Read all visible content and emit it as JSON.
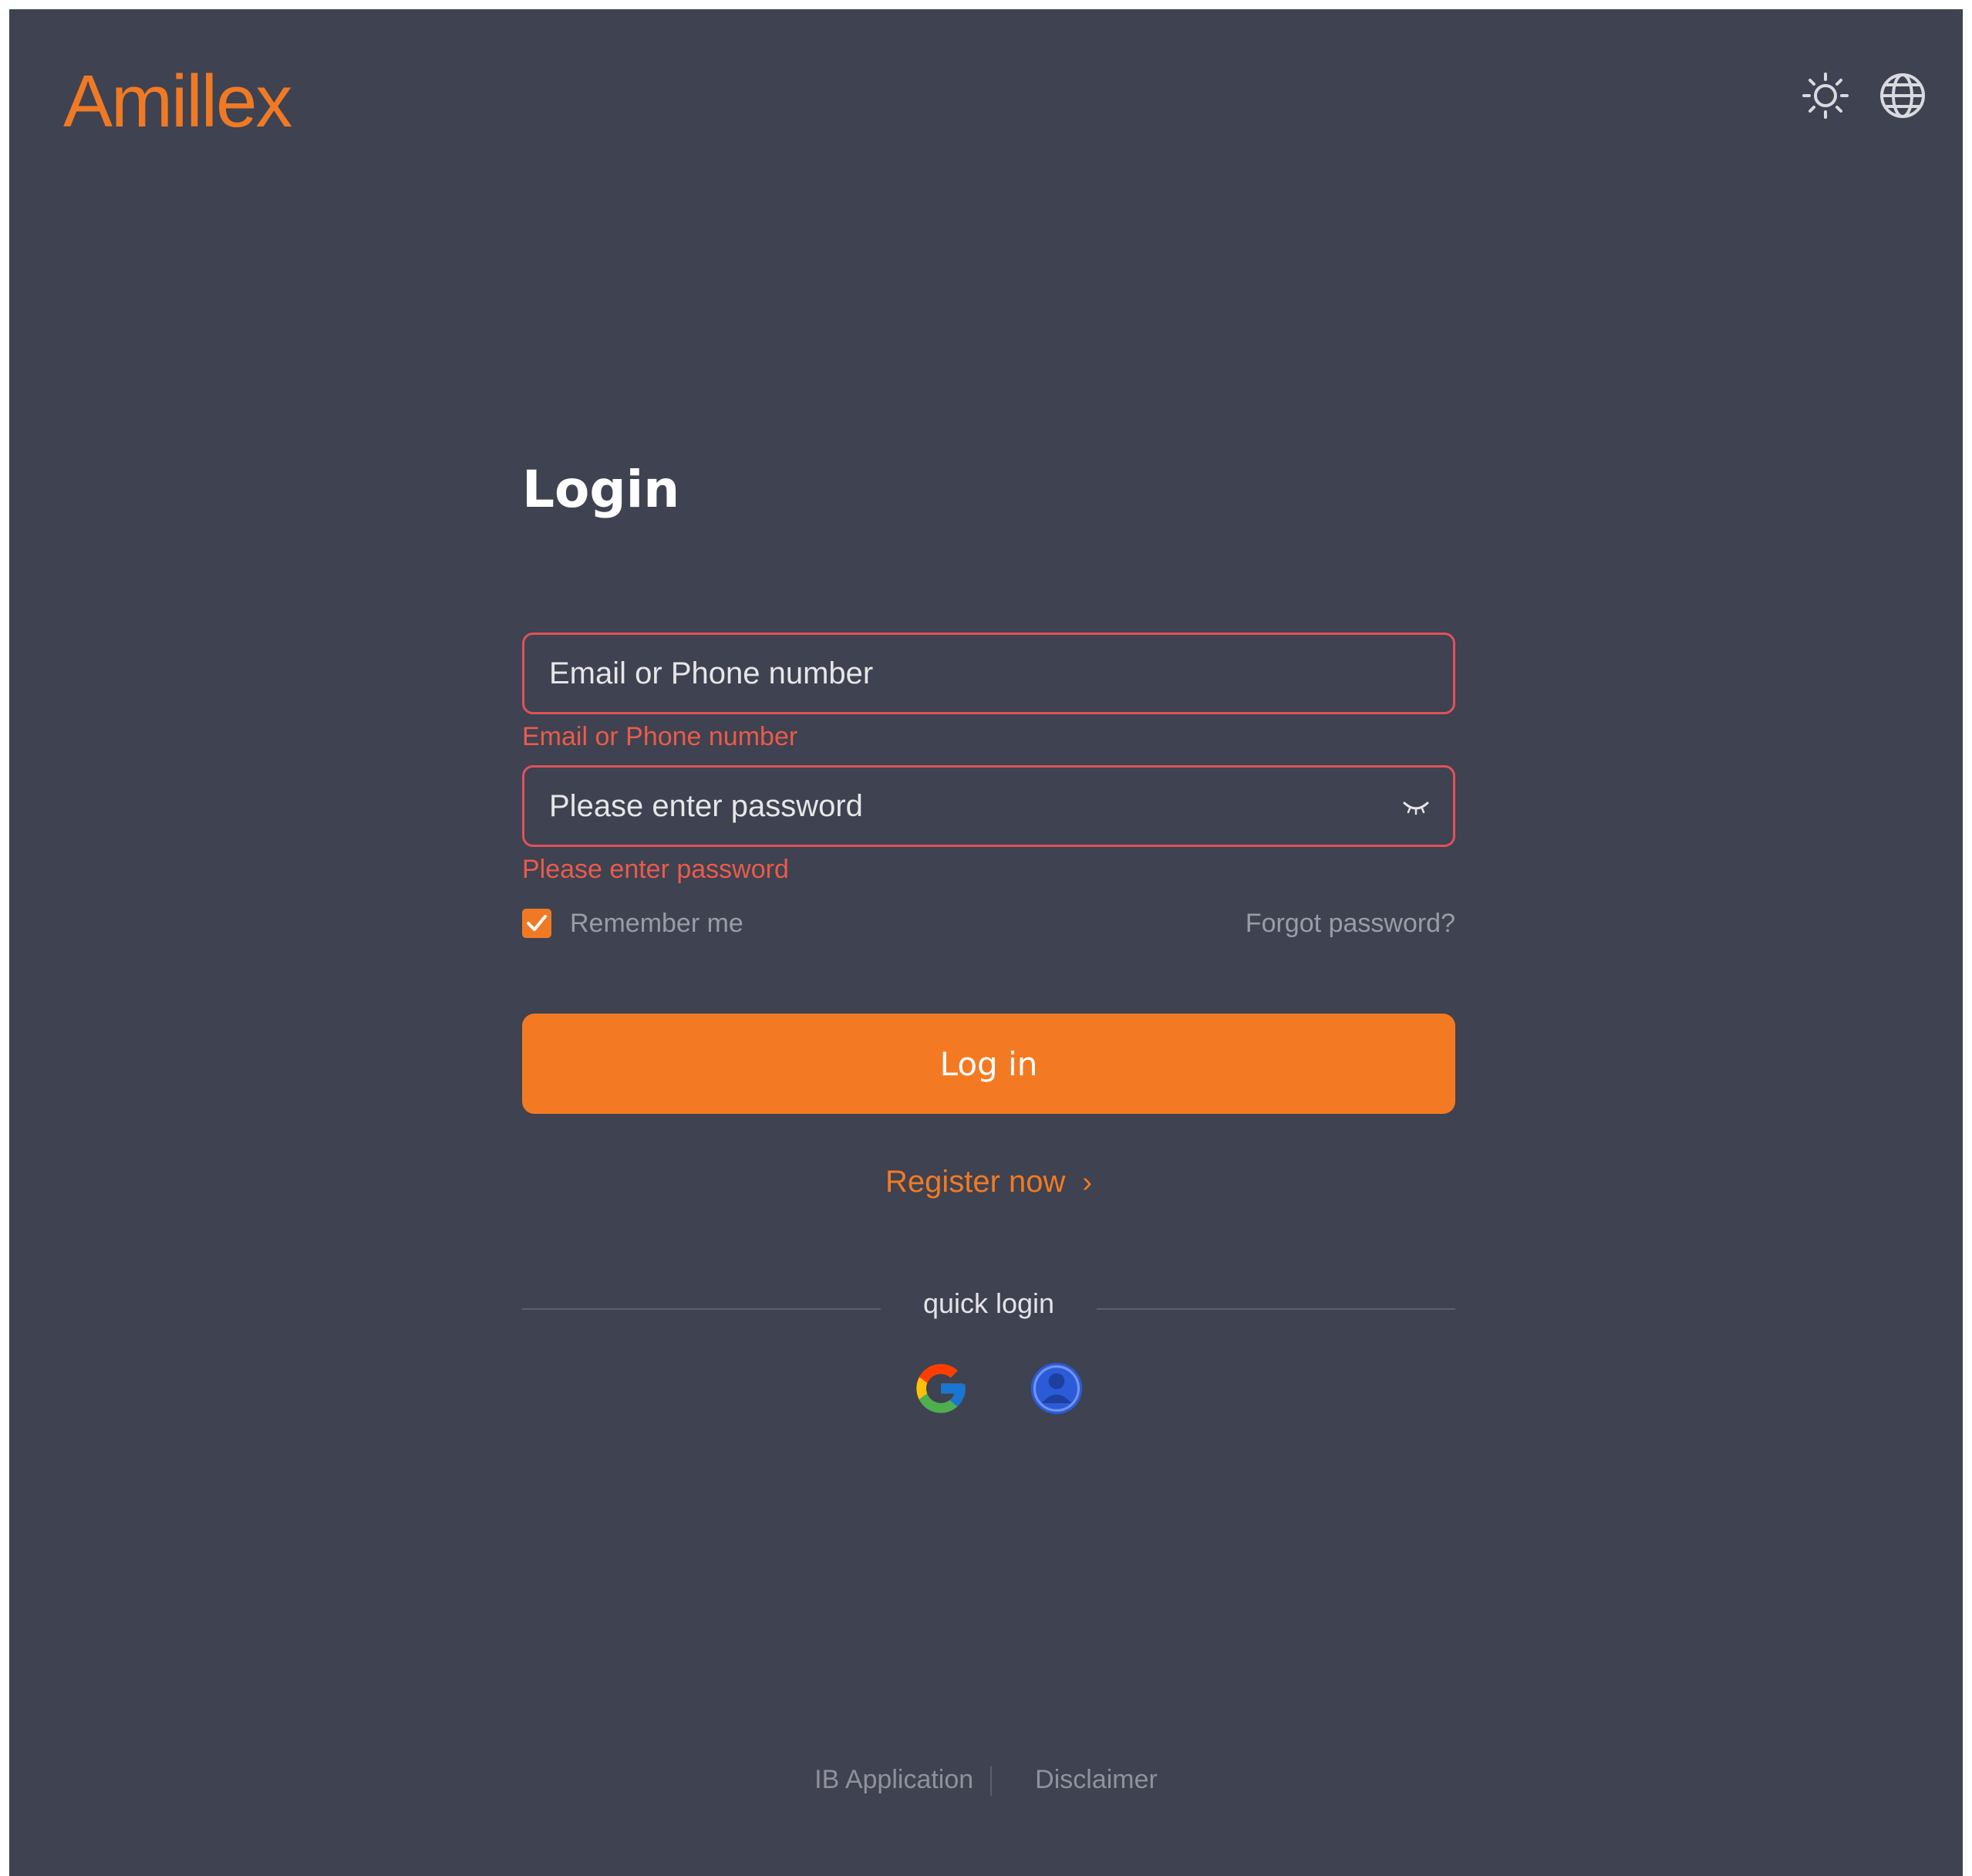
{
  "brand": {
    "name": "Amillex",
    "color": "#f07a24"
  },
  "header": {
    "theme_icon": "sun-icon",
    "language_icon": "globe-icon"
  },
  "login": {
    "title": "Login",
    "email": {
      "placeholder": "Email or Phone number",
      "value": "",
      "error": "Email or Phone number"
    },
    "password": {
      "placeholder": "Please enter password",
      "value": "",
      "error": "Please enter password",
      "toggle_icon": "eye-closed-icon"
    },
    "remember_me": {
      "label": "Remember me",
      "checked": true
    },
    "forgot_password": "Forgot password?",
    "submit_label": "Log in",
    "register_label": "Register now",
    "register_icon": "chevron-right-icon",
    "quick_login": {
      "label": "quick login",
      "providers": [
        {
          "name": "google-icon"
        },
        {
          "name": "user-account-icon"
        }
      ]
    }
  },
  "footer": {
    "links": [
      "IB Application",
      "Disclaimer"
    ]
  },
  "colors": {
    "background": "#3f4250",
    "accent": "#f37a22",
    "error": "#ea5b4b"
  }
}
